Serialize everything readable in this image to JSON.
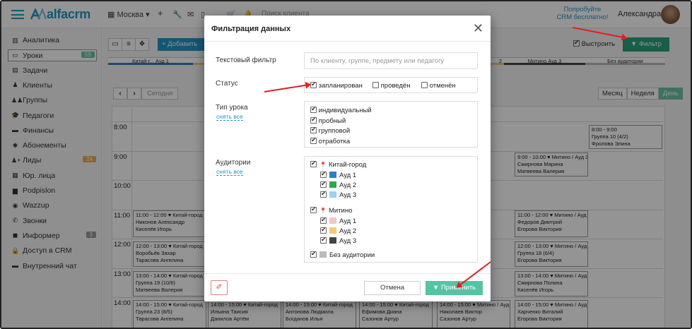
{
  "header": {
    "logo": "alfacrm",
    "branch": "Москва",
    "search_placeholder": "Поиск клиента",
    "promo_line1": "Попробуйте",
    "promo_line2": "CRM бесплатно!",
    "user_name": "Александра"
  },
  "sidebar": {
    "items": [
      {
        "label": "Аналитика",
        "icon": "chart-icon"
      },
      {
        "label": "Уроки",
        "icon": "calendar-icon",
        "badge": "59",
        "active": true
      },
      {
        "label": "Задачи",
        "icon": "tasks-icon"
      },
      {
        "label": "Клиенты",
        "icon": "user-icon"
      },
      {
        "label": "Группы",
        "icon": "group-icon"
      },
      {
        "label": "Педагоги",
        "icon": "graduation-icon"
      },
      {
        "label": "Финансы",
        "icon": "money-icon"
      },
      {
        "label": "Абонементы",
        "icon": "ticket-icon"
      },
      {
        "label": "Лиды",
        "icon": "add-user-icon",
        "badge": "24"
      },
      {
        "label": "Юр. лица",
        "icon": "building-icon"
      },
      {
        "label": "Podpislon",
        "icon": "document-icon"
      },
      {
        "label": "Wazzup",
        "icon": "whatsapp-icon"
      },
      {
        "label": "Звонки",
        "icon": "phone-icon"
      },
      {
        "label": "Информер",
        "icon": "informer-icon",
        "badge": "3"
      },
      {
        "label": "Доступ в CRM",
        "icon": "lock-icon"
      },
      {
        "label": "Внутренний чат",
        "icon": "chat-icon"
      }
    ],
    "badge_colors": {
      "lessons": "#6cc3a6",
      "leads": "#f0ad4e",
      "informer": "#999999"
    }
  },
  "toolbar": {
    "add_label": "+ Добавить",
    "align_label": "Выстроить",
    "filter_label": "Фильтр",
    "today_label": "Сегодня",
    "view_month": "Месяц",
    "view_week": "Неделя",
    "view_day": "День"
  },
  "rooms": [
    "Китай-г... Ауд 1",
    "2",
    "Митино Ауд 3",
    "Без аудитории"
  ],
  "times": [
    "8:00",
    "9:00",
    "10:00",
    "11:00",
    "12:00",
    "13:00",
    "14:00"
  ],
  "calendar_cards": [
    {
      "line1": "8:00 - 9:00",
      "line2": "Группа 10 (4/2)",
      "line3": "Фролова Элина"
    },
    {
      "line1": "9:00 - 10:00 ♥ Митино / Ауд 3",
      "line2": "Смирнова Марина",
      "line3": "Матвеева Валерия"
    },
    {
      "line1": "11:00 - 12:00 ♥ Китай-город",
      "line2": "Никонов Александр",
      "line3": "Киселёв Игорь"
    },
    {
      "line1": "11:00 - 12:00 ♥ Митино / Ауд",
      "line2": "Федоров Дмитрий",
      "line3": "Егорова Виктория"
    },
    {
      "line1": "12:00 - 13:00 ♥ Китай-город",
      "line2": "Воробьёв Захар",
      "line3": "Тарасова Ангелина"
    },
    {
      "line1": "12:00 - 13:00 ♥ Митино / Ауд",
      "line2": "Группа 18 (6/4)",
      "line3": "Егорова Виктория"
    },
    {
      "line1": "13:00 - 14:00 ♥ Китай-город",
      "line2": "Группа 19 (10/6)",
      "line3": "Матвеева Валерия"
    },
    {
      "line1": "13:00 - 14:00 ♥ Митино / Ауд",
      "line2": "Смирнова Полина",
      "line3": "Киселёв Игорь"
    },
    {
      "line1": "14:00 - 15:00 ♥ Китай-город",
      "line2": "Группа 23 (8/5)",
      "line3": "Тарасова Ангелина"
    },
    {
      "line1": "14:00 - 15:00 ♥ Китай-город",
      "line2": "Ильина Таисия",
      "line3": "Данилов Артём"
    },
    {
      "line1": "14:00 - 15:00 ♥ Китай-город",
      "line2": "Антонова Людмила",
      "line3": "Богданов Илья"
    },
    {
      "line1": "14:00 - 15:00 ♥ Китай-город",
      "line2": "Ефимова Диана",
      "line3": "Сазонов Артур"
    },
    {
      "line1": "14:00 - 15:00 ♥ Митино / Ауд",
      "line2": "Николаев Виктор",
      "line3": "Сазонов Артур"
    },
    {
      "line1": "14:00 - 15:00 ♥ Митино / Ауд",
      "line2": "Харченко Виталий",
      "line3": "Егорова Виктория"
    }
  ],
  "modal": {
    "title": "Фильтрация данных",
    "text_filter_label": "Текстовый фильтр",
    "text_filter_placeholder": "По клиенту, группе, предмету или педагогу",
    "status_label": "Статус",
    "status_options": [
      {
        "label": "запланирован",
        "checked": true
      },
      {
        "label": "проведён",
        "checked": false
      },
      {
        "label": "отменён",
        "checked": false
      }
    ],
    "lesson_type_label": "Тип урока",
    "clear_all": "снять все",
    "lesson_types": [
      {
        "label": "индивидуальный",
        "checked": true
      },
      {
        "label": "пробный",
        "checked": true
      },
      {
        "label": "групповой",
        "checked": true
      },
      {
        "label": "отработка",
        "checked": true
      }
    ],
    "rooms_label": "Аудитории",
    "room_groups": [
      {
        "name": "Китай-город",
        "rooms": [
          {
            "label": "Ауд 1",
            "color": "#2f7fc1"
          },
          {
            "label": "Ауд 2",
            "color": "#2ea84a"
          },
          {
            "label": "Ауд 3",
            "color": "#9fd0ee"
          }
        ]
      },
      {
        "name": "Митино",
        "rooms": [
          {
            "label": "Ауд 1",
            "color": "#f5c7c7"
          },
          {
            "label": "Ауд 2",
            "color": "#f5c97a"
          },
          {
            "label": "Ауд 3",
            "color": "#444444"
          }
        ]
      }
    ],
    "no_room_label": "Без аудитории",
    "no_room_color": "#bbbbbb",
    "cancel_label": "Отмена",
    "apply_label": "Применить"
  }
}
